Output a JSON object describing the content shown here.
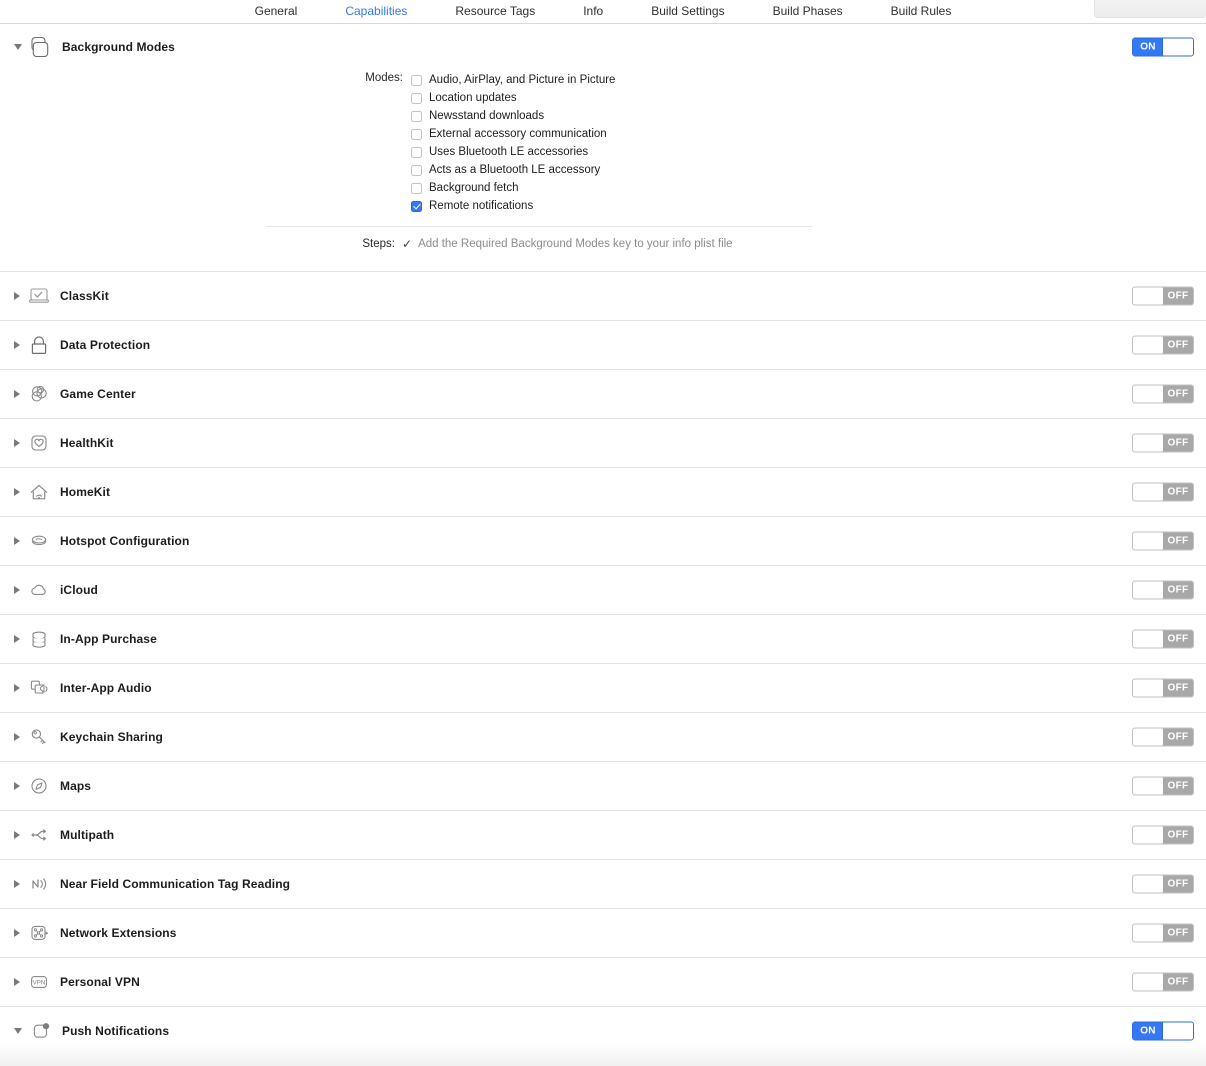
{
  "colors": {
    "accent_blue": "#3478f6",
    "toggle_off_gray": "#a8a8a8",
    "separator": "#e3e3e3",
    "title_text": "#1d1d1d",
    "muted_text": "#8c8c8c"
  },
  "tabs": [
    {
      "label": "General",
      "active": false
    },
    {
      "label": "Capabilities",
      "active": true
    },
    {
      "label": "Resource Tags",
      "active": false
    },
    {
      "label": "Info",
      "active": false
    },
    {
      "label": "Build Settings",
      "active": false
    },
    {
      "label": "Build Phases",
      "active": false
    },
    {
      "label": "Build Rules",
      "active": false
    }
  ],
  "background_modes": {
    "title": "Background Modes",
    "expanded": true,
    "toggle_state": "ON",
    "modes_label": "Modes:",
    "modes": [
      {
        "label": "Audio, AirPlay, and Picture in Picture",
        "checked": false
      },
      {
        "label": "Location updates",
        "checked": false
      },
      {
        "label": "Newsstand downloads",
        "checked": false
      },
      {
        "label": "External accessory communication",
        "checked": false
      },
      {
        "label": "Uses Bluetooth LE accessories",
        "checked": false
      },
      {
        "label": "Acts as a Bluetooth LE accessory",
        "checked": false
      },
      {
        "label": "Background fetch",
        "checked": false
      },
      {
        "label": "Remote notifications",
        "checked": true
      }
    ],
    "steps_label": "Steps:",
    "steps_check": "✓",
    "steps_text": "Add the Required Background Modes key to your info plist file"
  },
  "capabilities": [
    {
      "title": "ClassKit",
      "icon": "classkit-icon",
      "toggle_state": "OFF",
      "expanded": false
    },
    {
      "title": "Data Protection",
      "icon": "lock-icon",
      "toggle_state": "OFF",
      "expanded": false
    },
    {
      "title": "Game Center",
      "icon": "game-center-icon",
      "toggle_state": "OFF",
      "expanded": false
    },
    {
      "title": "HealthKit",
      "icon": "healthkit-icon",
      "toggle_state": "OFF",
      "expanded": false
    },
    {
      "title": "HomeKit",
      "icon": "homekit-icon",
      "toggle_state": "OFF",
      "expanded": false
    },
    {
      "title": "Hotspot Configuration",
      "icon": "hotspot-icon",
      "toggle_state": "OFF",
      "expanded": false
    },
    {
      "title": "iCloud",
      "icon": "icloud-icon",
      "toggle_state": "OFF",
      "expanded": false
    },
    {
      "title": "In-App Purchase",
      "icon": "in-app-purchase-icon",
      "toggle_state": "OFF",
      "expanded": false
    },
    {
      "title": "Inter-App Audio",
      "icon": "inter-app-audio-icon",
      "toggle_state": "OFF",
      "expanded": false
    },
    {
      "title": "Keychain Sharing",
      "icon": "key-icon",
      "toggle_state": "OFF",
      "expanded": false
    },
    {
      "title": "Maps",
      "icon": "maps-icon",
      "toggle_state": "OFF",
      "expanded": false
    },
    {
      "title": "Multipath",
      "icon": "multipath-icon",
      "toggle_state": "OFF",
      "expanded": false
    },
    {
      "title": "Near Field Communication Tag Reading",
      "icon": "nfc-icon",
      "toggle_state": "OFF",
      "expanded": false
    },
    {
      "title": "Network Extensions",
      "icon": "network-extension-icon",
      "toggle_state": "OFF",
      "expanded": false
    },
    {
      "title": "Personal VPN",
      "icon": "vpn-icon",
      "toggle_state": "OFF",
      "expanded": false
    },
    {
      "title": "Push Notifications",
      "icon": "push-notifications-icon",
      "toggle_state": "ON",
      "expanded": true
    }
  ]
}
